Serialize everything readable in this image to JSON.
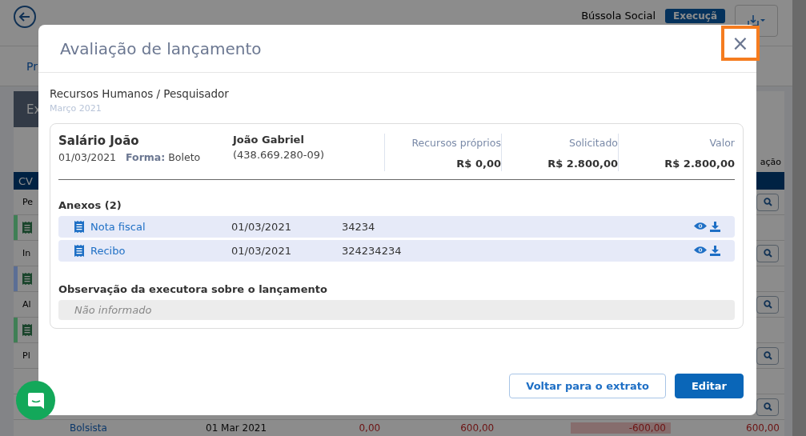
{
  "background": {
    "header": {
      "org": "Bússola Social",
      "stage_button": "Execuçã"
    },
    "tab": "Pr",
    "panel_tab": "Ex",
    "column_header": "ação",
    "first_column_header": "CV",
    "rows": [
      {
        "kind": "text",
        "label": "Pe",
        "search": true
      },
      {
        "kind": "icon",
        "color": "#3f7f55"
      },
      {
        "kind": "text",
        "label": "In",
        "search": true
      },
      {
        "kind": "icon",
        "color": "#5b6e95"
      },
      {
        "kind": "text",
        "label": "Al",
        "search": true
      },
      {
        "kind": "icon",
        "color": "#3f7f55"
      },
      {
        "kind": "text",
        "label": "Pl",
        "search": true
      },
      {
        "kind": "blank",
        "search": false
      },
      {
        "kind": "blank",
        "search": true
      }
    ],
    "bottom_row": {
      "name": "Bolsista",
      "date": "01 Mar 2021",
      "col_a": "0,00",
      "col_b": "600,00",
      "col_c": "-600,00",
      "col_d": "600,00"
    }
  },
  "modal": {
    "title": "Avaliação de lançamento",
    "close_label": "×",
    "category": "Recursos Humanos / Pesquisador",
    "period": "Março 2021",
    "entry": {
      "name": "Salário João",
      "date": "01/03/2021",
      "method_label": "Forma:",
      "method": "Boleto",
      "person": "João Gabriel",
      "document": "(438.669.280-09)",
      "amounts": [
        {
          "label": "Recursos próprios",
          "value": "R$ 0,00"
        },
        {
          "label": "Solicitado",
          "value": "R$ 2.800,00"
        },
        {
          "label": "Valor",
          "value": "R$ 2.800,00"
        }
      ]
    },
    "attachments_title": "Anexos (2)",
    "attachments": [
      {
        "name": "Nota fiscal",
        "date": "01/03/2021",
        "number": "34234"
      },
      {
        "name": "Recibo",
        "date": "01/03/2021",
        "number": "324234234"
      }
    ],
    "observation_title": "Observação da executora sobre o lançamento",
    "observation": {
      "placeholder": "Não informado"
    },
    "buttons": [
      {
        "label": "Voltar para o extrato",
        "kind": "secondary"
      },
      {
        "label": "Editar",
        "kind": "primary"
      }
    ]
  }
}
